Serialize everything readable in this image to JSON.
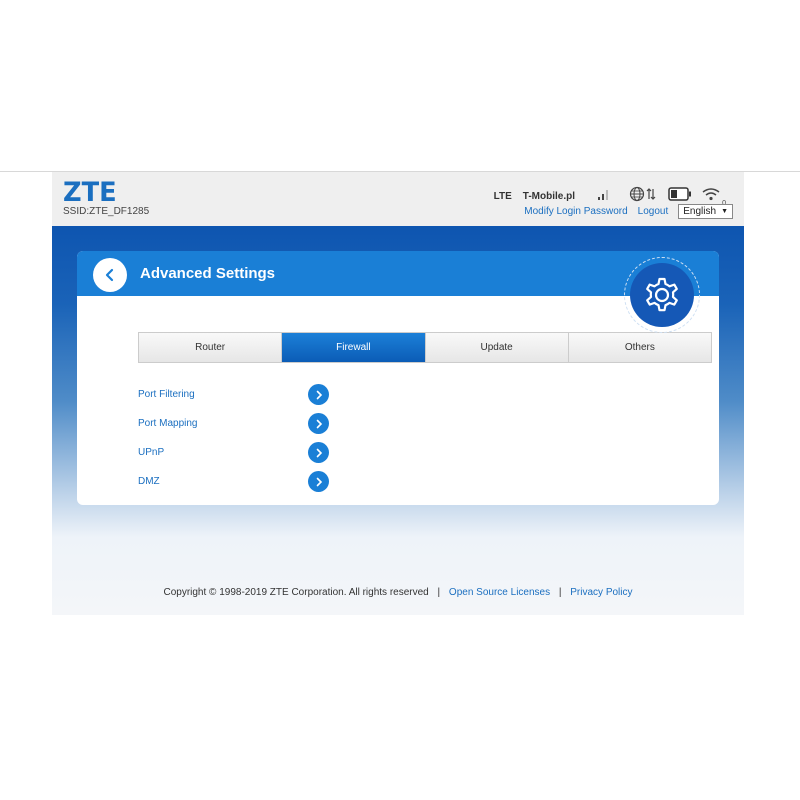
{
  "header": {
    "logo": "ZTE",
    "ssid": "SSID:ZTE_DF1285",
    "network_type": "LTE",
    "carrier": "T-Mobile.pl",
    "wifi_count": "0",
    "modify_password": "Modify Login Password",
    "logout": "Logout",
    "language": "English"
  },
  "icons": [
    "signal-icon",
    "globe-icon",
    "data-transfer-icon",
    "battery-icon",
    "wifi-icon",
    "back-arrow-icon",
    "gear-icon",
    "chevron-right-icon"
  ],
  "colors": {
    "brand": "#1b6fc0",
    "accent": "#1a7fd6",
    "tab_active": "#0b5cb6"
  },
  "card": {
    "title": "Advanced Settings",
    "tabs": [
      {
        "label": "Router",
        "active": false
      },
      {
        "label": "Firewall",
        "active": true
      },
      {
        "label": "Update",
        "active": false
      },
      {
        "label": "Others",
        "active": false
      }
    ],
    "items": [
      {
        "label": "Port Filtering"
      },
      {
        "label": "Port Mapping"
      },
      {
        "label": "UPnP"
      },
      {
        "label": "DMZ"
      }
    ]
  },
  "footer": {
    "copyright": "Copyright © 1998-2019 ZTE Corporation. All rights reserved",
    "sep": "|",
    "open_source": "Open Source Licenses",
    "privacy": "Privacy Policy"
  }
}
